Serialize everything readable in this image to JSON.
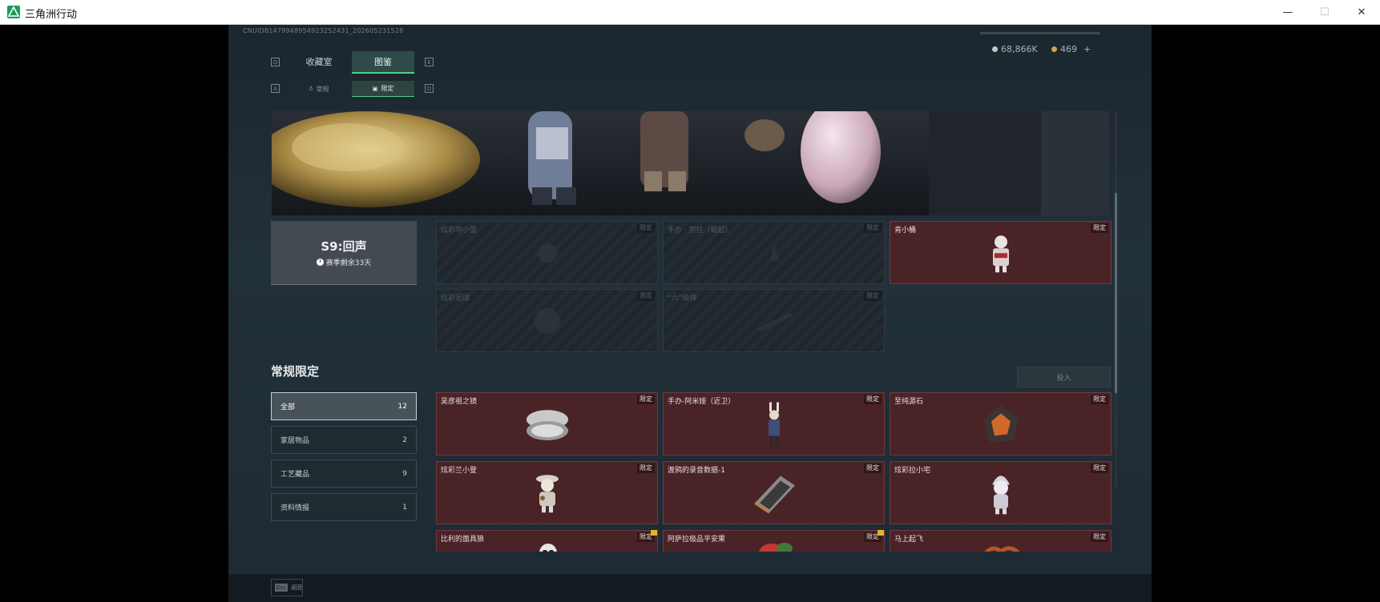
{
  "window": {
    "title": "三角洲行动",
    "minimize": "—",
    "maximize": "☐",
    "close": "✕"
  },
  "uid": "CNUID81479948954923252431_202605231528",
  "currency": {
    "silver": "68,866K",
    "gold": "469",
    "add": "+"
  },
  "keys": {
    "q": "Q",
    "e": "E",
    "a": "A",
    "d": "D"
  },
  "tabs": [
    {
      "label": "收藏室"
    },
    {
      "label": "图鉴"
    }
  ],
  "subtabs": [
    {
      "label": "常规"
    },
    {
      "label": "限定"
    }
  ],
  "season": {
    "name": "S9:回声",
    "remaining": "赛季剩余33天"
  },
  "season_cards": [
    {
      "name": "炫彩鸟小蛋",
      "tag": "限定",
      "locked": true
    },
    {
      "name": "手办 · 劳拉（崛起）",
      "tag": "限定",
      "locked": true
    },
    {
      "name": "肯小桶",
      "tag": "限定",
      "locked": false
    },
    {
      "name": "炫彩足球",
      "tag": "限定",
      "locked": true
    },
    {
      "name": "“六”级弹",
      "tag": "限定",
      "locked": true
    }
  ],
  "section": {
    "title": "常规限定",
    "import_label": "投入"
  },
  "categories": [
    {
      "label": "全部",
      "count": "12"
    },
    {
      "label": "家居物品",
      "count": "2"
    },
    {
      "label": "工艺藏品",
      "count": "9"
    },
    {
      "label": "资料情报",
      "count": "1"
    }
  ],
  "items": [
    {
      "name": "吴彦祖之镜",
      "tag": "限定",
      "icon": "mirror-icon"
    },
    {
      "name": "手办-阿米娅（近卫）",
      "tag": "限定",
      "icon": "figure-icon"
    },
    {
      "name": "至纯源石",
      "tag": "限定",
      "icon": "gem-icon"
    },
    {
      "name": "炫彩兰小登",
      "tag": "限定",
      "icon": "toy-icon"
    },
    {
      "name": "渡鸦的录音数据-1",
      "tag": "限定",
      "icon": "data-chip-icon"
    },
    {
      "name": "炫彩拉小宅",
      "tag": "限定",
      "icon": "toy-icon"
    },
    {
      "name": "比利的面具狼",
      "tag": "限定",
      "icon": "mask-icon"
    },
    {
      "name": "阿萨拉极品平安果",
      "tag": "限定",
      "icon": "apple-icon"
    },
    {
      "name": "马上起飞",
      "tag": "限定",
      "icon": "horse-icon"
    }
  ],
  "footer": {
    "esc_key": "Esc",
    "esc_label": "返回"
  },
  "colors": {
    "accent": "#4fd08c",
    "card": "#4a2327",
    "panel": "#1b262e"
  }
}
